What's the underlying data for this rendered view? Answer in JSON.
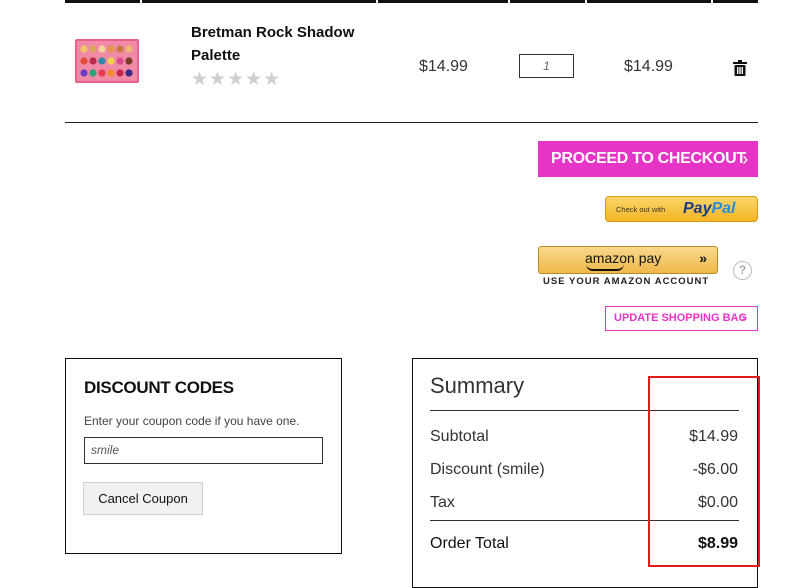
{
  "product": {
    "name": "Bretman Rock Shadow Palette",
    "rating_stars": "★★★★★",
    "rating_value": 0,
    "price": "$14.99",
    "quantity": "1",
    "subtotal": "$14.99",
    "image_icon": "eyeshadow-palette-image"
  },
  "actions": {
    "checkout_label": "PROCEED TO CHECKOUT",
    "checkout_chevron": "›",
    "paypal_small": "Check out with",
    "paypal_logo_1": "Pay",
    "paypal_logo_2": "Pal",
    "amazon_label": "amazon pay",
    "amazon_arrows": "»",
    "amazon_sub": "USE YOUR AMAZON ACCOUNT",
    "help_glyph": "?",
    "update_label": "UPDATE SHOPPING BAG",
    "update_chevron": ">"
  },
  "discount": {
    "title": "DISCOUNT CODES",
    "hint": "Enter your coupon code if you have one.",
    "code_value": "smile",
    "cancel_label": "Cancel Coupon"
  },
  "summary": {
    "title": "Summary",
    "rows": [
      {
        "label": "Subtotal",
        "value": "$14.99"
      },
      {
        "label": "Discount (smile)",
        "value": "-$6.00"
      },
      {
        "label": "Tax",
        "value": "$0.00"
      }
    ],
    "total_label": "Order Total",
    "total_value": "$8.99"
  },
  "colors": {
    "accent_pink": "#e534c6",
    "highlight_red": "#e21b1b",
    "paypal_gold": "#f4b526"
  }
}
